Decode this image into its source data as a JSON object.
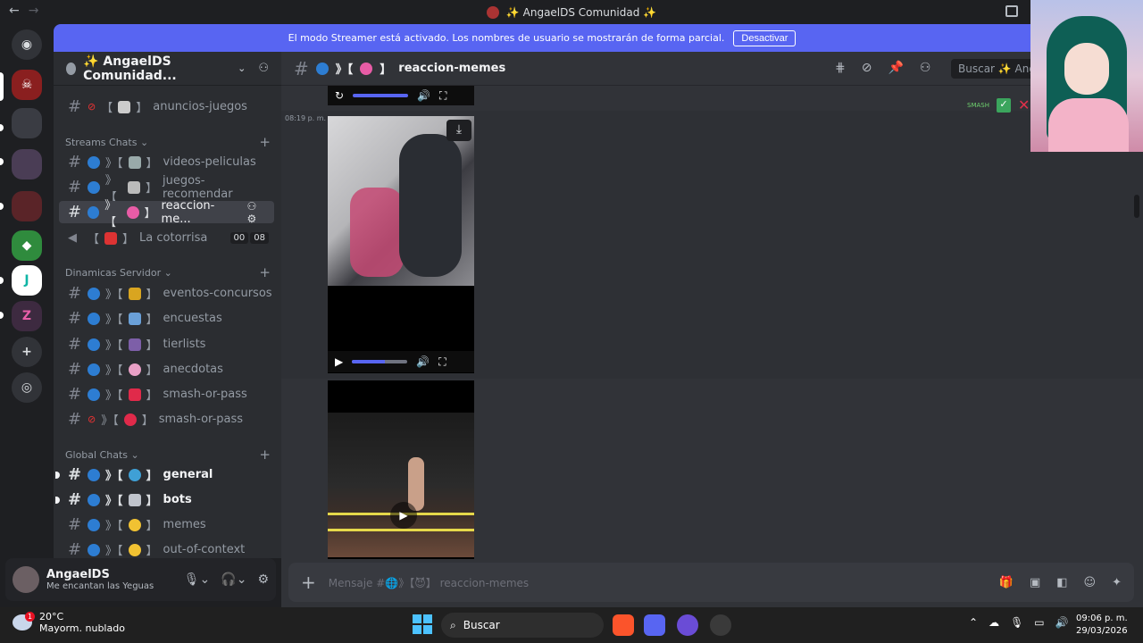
{
  "window": {
    "title": "✨ AngaelDS Comunidad ✨",
    "back": "←",
    "forward": "→"
  },
  "banner": {
    "text": "El modo Streamer está activado. Los nombres de usuario se mostrarán de forma parcial.",
    "button": "Desactivar"
  },
  "server": {
    "name": "✨ AngaelDS Comunidad...",
    "chevron": "⌄"
  },
  "categories": {
    "streams": "Streams Chats ⌄",
    "dinamicas": "Dinamicas Servidor ⌄",
    "global": "Global Chats ⌄"
  },
  "channels": {
    "anuncios": "anuncios-juegos",
    "videos": "videos-peliculas",
    "juegos": "juegos-recomendar",
    "reaccion": "reaccion-me...",
    "cotorrisa": "La cotorrisa",
    "cotorrisa_count_a": "00",
    "cotorrisa_count_b": "08",
    "eventos": "eventos-concursos",
    "encuestas": "encuestas",
    "tierlists": "tierlists",
    "anecdotas": "anecdotas",
    "smash1": "smash-or-pass",
    "smash2": "smash-or-pass",
    "general": "general",
    "bots": "bots",
    "memes": "memes",
    "ooc": "out-of-context"
  },
  "user": {
    "name": "AngaelDS",
    "status": "Me encantan las Yeguas"
  },
  "header": {
    "channel": "reaccion-memes",
    "search_placeholder": "Buscar ✨ Anga"
  },
  "message": {
    "timestamp": "08:19 p. m."
  },
  "players": {
    "top_progress": 1.0,
    "mid_progress": 0.6
  },
  "composer": {
    "placeholder": "Mensaje #🌐》【😈】 reaccion-memes"
  },
  "taskbar": {
    "temp": "20°C",
    "weather": "Mayorm. nublado",
    "weather_badge": "1",
    "search": "Buscar",
    "time": "09:06 p. m.",
    "date": "29/03/2026"
  },
  "colors": {
    "accent": "#5865f2",
    "sidebar": "#2b2d31",
    "main": "#313338"
  }
}
